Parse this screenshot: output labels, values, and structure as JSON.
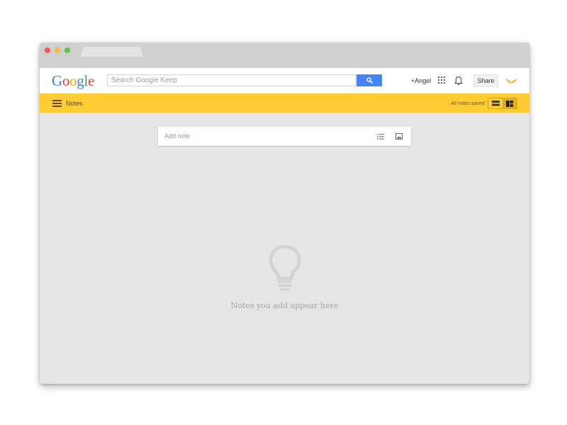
{
  "browser": {
    "tab_title": ""
  },
  "header": {
    "logo_text": "Google",
    "search_placeholder": "Search Google Keep",
    "user_link": "+Angel",
    "share_label": "Share"
  },
  "toolbar": {
    "section_label": "Notes",
    "save_status": "All notes saved",
    "view_modes": [
      "list-view-icon",
      "grid-view-icon"
    ],
    "active_view": "grid-view"
  },
  "note_input": {
    "placeholder": "Add note"
  },
  "empty_state": {
    "message": "Notes you add appear here"
  },
  "colors": {
    "accent": "#ffcc33",
    "search_button": "#4285f4",
    "background": "#e5e5e5"
  }
}
